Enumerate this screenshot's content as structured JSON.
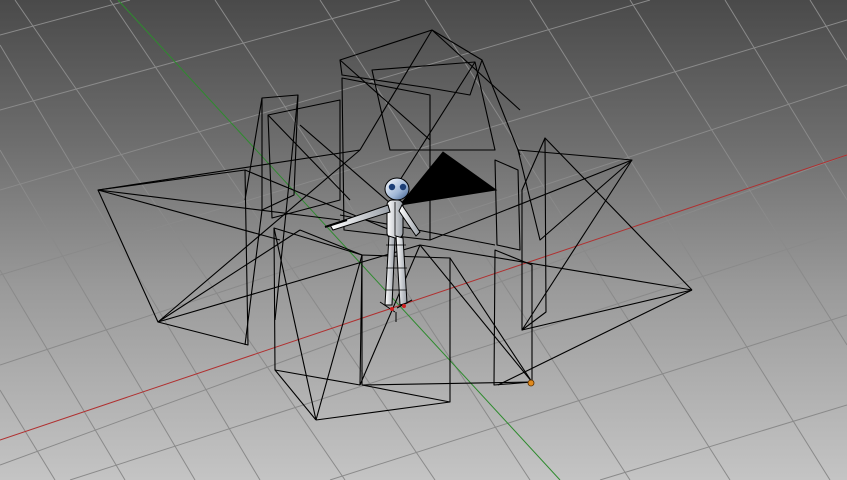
{
  "viewport": {
    "view_type": "3D perspective viewport",
    "grid_visible": true,
    "x_axis_color": "#b03030",
    "y_axis_color": "#2e8b2e",
    "wire_color": "#000000",
    "grid_color": "#8a8a8a"
  },
  "scene": {
    "objects": [
      {
        "name": "character-rig",
        "kind": "armature-figure"
      },
      {
        "name": "light-cone",
        "kind": "spotlight"
      },
      {
        "name": "camera-frames",
        "kind": "wireframe-camera-array"
      },
      {
        "name": "selected-origin",
        "kind": "object-origin",
        "color": "#e08a1e"
      }
    ]
  }
}
